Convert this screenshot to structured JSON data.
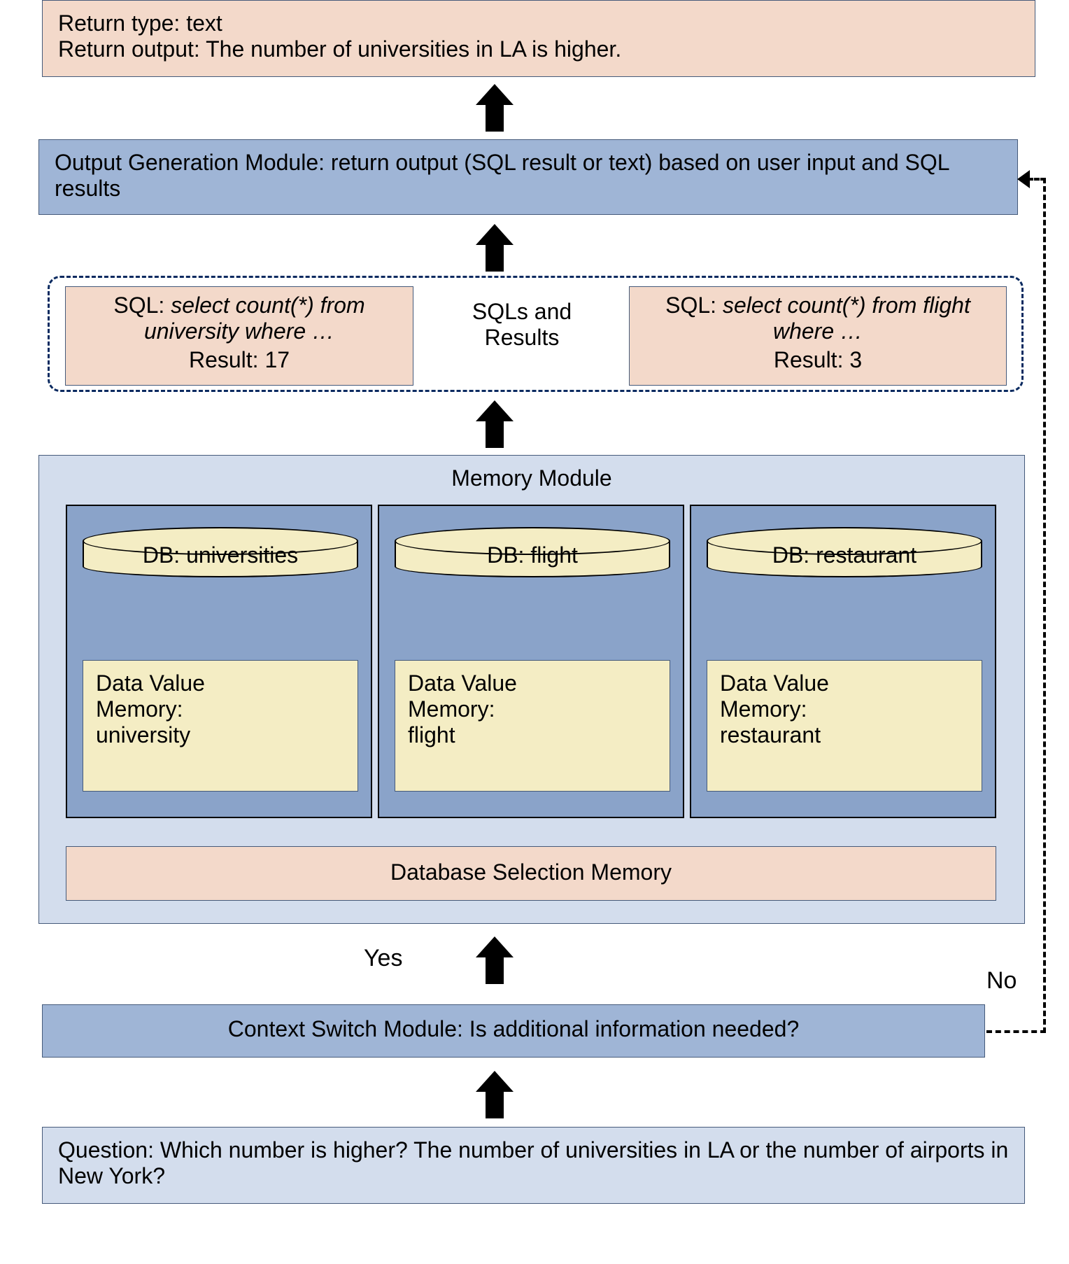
{
  "return_box": {
    "line1": "Return type: text",
    "line2": "Return output: The number of universities in LA is higher."
  },
  "output_module": {
    "text": "Output Generation Module: return output (SQL result or text) based on user input and SQL results"
  },
  "sqls": {
    "mid_label_line1": "SQLs and",
    "mid_label_line2": "Results",
    "left": {
      "sql_prefix": "SQL: ",
      "sql_italic": "select count(*) from university where …",
      "result": "Result: 17"
    },
    "right": {
      "sql_prefix": "SQL: ",
      "sql_italic": "select count(*) from flight where …",
      "result": "Result: 3"
    }
  },
  "memory": {
    "title": "Memory Module",
    "dbs": [
      {
        "cyl": "DB: universities",
        "dv_line1": "Data Value",
        "dv_line2": "Memory:",
        "dv_line3": "university"
      },
      {
        "cyl": "DB: flight",
        "dv_line1": "Data Value",
        "dv_line2": "Memory:",
        "dv_line3": "flight"
      },
      {
        "cyl": "DB: restaurant",
        "dv_line1": "Data Value",
        "dv_line2": "Memory:",
        "dv_line3": "restaurant"
      }
    ],
    "selection_memory": "Database Selection Memory"
  },
  "labels": {
    "yes": "Yes",
    "no": "No"
  },
  "context_switch": {
    "text": "Context Switch Module: Is additional information needed?"
  },
  "question": {
    "text": "Question: Which number is higher? The number of universities in LA or the number of airports in New York?"
  }
}
